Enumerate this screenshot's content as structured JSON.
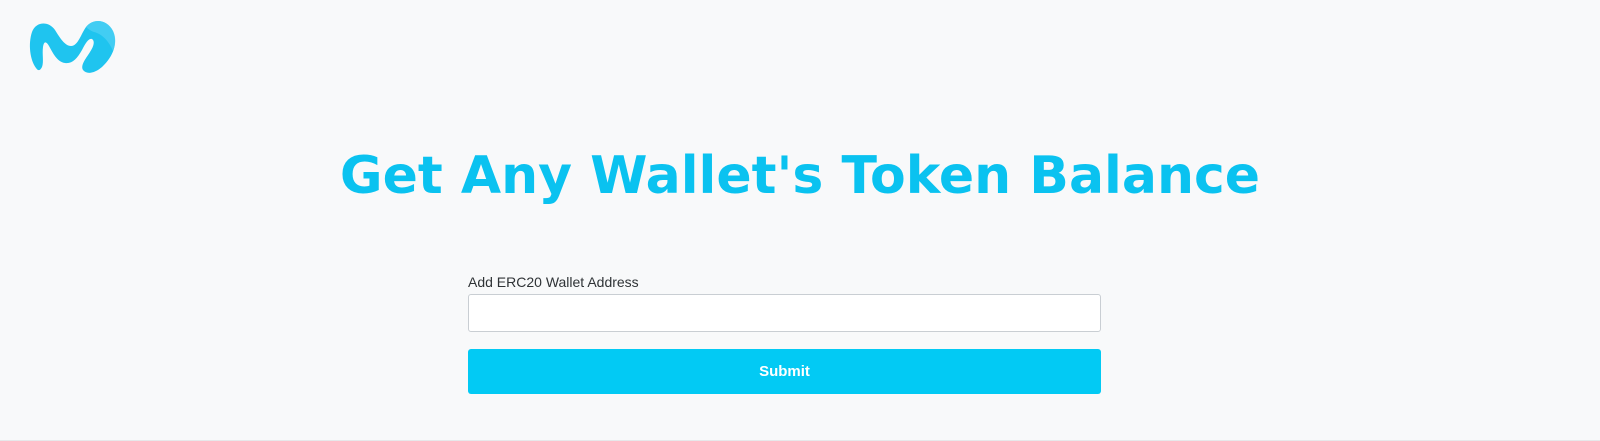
{
  "header": {
    "logo_icon": "moralis-logo-icon",
    "logo_color": "#1fc4ef"
  },
  "main": {
    "title": "Get Any Wallet's Token Balance",
    "title_color": "#0ac2f0",
    "form": {
      "address_label": "Add ERC20 Wallet Address",
      "address_value": "",
      "address_placeholder": "",
      "submit_label": "Submit",
      "submit_color": "#02caf4"
    }
  }
}
